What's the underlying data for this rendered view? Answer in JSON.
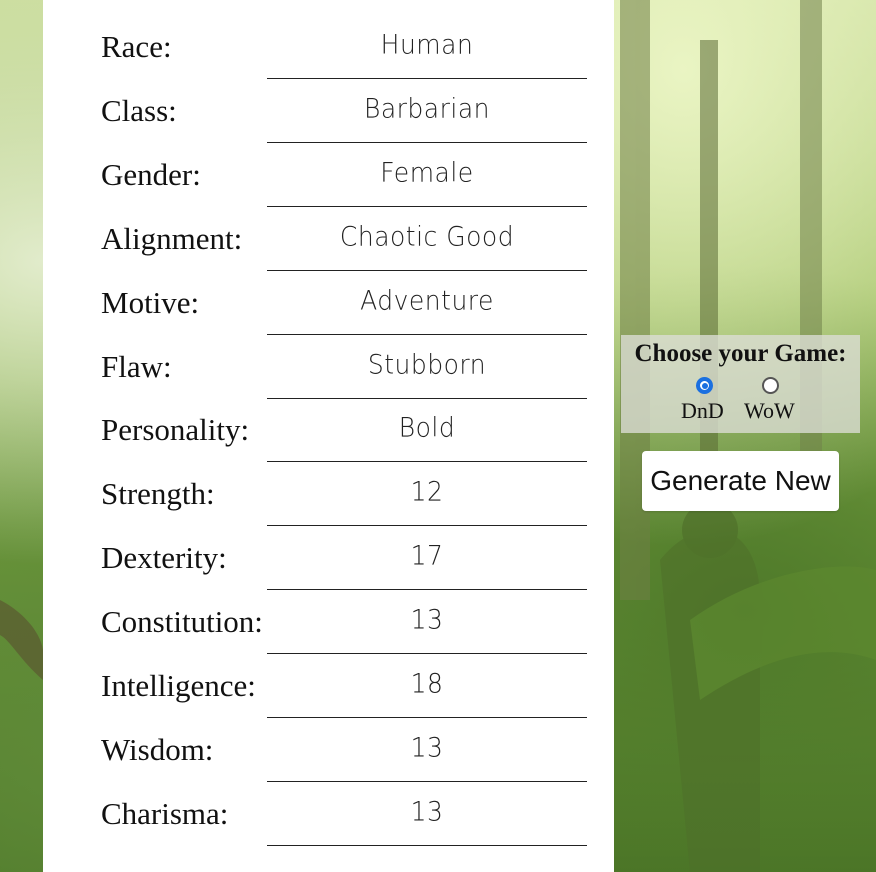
{
  "character": {
    "fields": [
      {
        "label": "Race:",
        "value": "Human"
      },
      {
        "label": "Class:",
        "value": "Barbarian"
      },
      {
        "label": "Gender:",
        "value": "Female"
      },
      {
        "label": "Alignment:",
        "value": "Chaotic Good"
      },
      {
        "label": "Motive:",
        "value": "Adventure"
      },
      {
        "label": "Flaw:",
        "value": "Stubborn"
      },
      {
        "label": "Personality:",
        "value": "Bold"
      },
      {
        "label": "Strength:",
        "value": "12"
      },
      {
        "label": "Dexterity:",
        "value": "17"
      },
      {
        "label": "Constitution:",
        "value": "13"
      },
      {
        "label": "Intelligence:",
        "value": "18"
      },
      {
        "label": "Wisdom:",
        "value": "13"
      },
      {
        "label": "Charisma:",
        "value": "13"
      }
    ]
  },
  "game_select": {
    "title": "Choose your Game:",
    "options": [
      {
        "label": "DnD",
        "selected": true
      },
      {
        "label": "WoW",
        "selected": false
      }
    ]
  },
  "generate_button": {
    "label": "Generate New"
  },
  "colors": {
    "radio_accent": "#1a6fe0",
    "panel_bg": "#ffffff"
  }
}
